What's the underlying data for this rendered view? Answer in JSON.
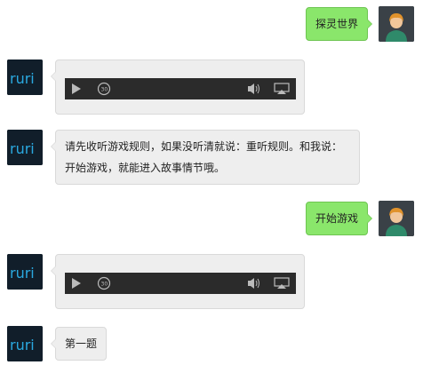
{
  "conversation": {
    "messages": [
      {
        "sender": "user",
        "type": "text",
        "text": "探灵世界"
      },
      {
        "sender": "bot",
        "type": "audio",
        "controls": [
          "play-icon",
          "rewind-30-icon",
          "volume-icon",
          "airplay-icon"
        ],
        "skip_seconds": "30"
      },
      {
        "sender": "bot",
        "type": "text",
        "lines": [
          "请先收听游戏规则，如果没听清就说：重听规则。和我说：",
          "开始游戏，就能进入故事情节哦。"
        ]
      },
      {
        "sender": "user",
        "type": "text",
        "text": "开始游戏"
      },
      {
        "sender": "bot",
        "type": "audio",
        "controls": [
          "play-icon",
          "rewind-30-icon",
          "volume-icon",
          "airplay-icon"
        ],
        "skip_seconds": "30"
      },
      {
        "sender": "bot",
        "type": "text",
        "text": "第一题"
      }
    ]
  },
  "avatars": {
    "bot_logo": "ruri",
    "user_icon": "person-avatar-icon"
  },
  "colors": {
    "user_bubble": "#8ae66b",
    "bot_bubble": "#eeeeee",
    "player_bar": "#2b2b2b",
    "bot_logo_text": "#2aa9e0",
    "user_avatar_hair": "#e0922b"
  }
}
